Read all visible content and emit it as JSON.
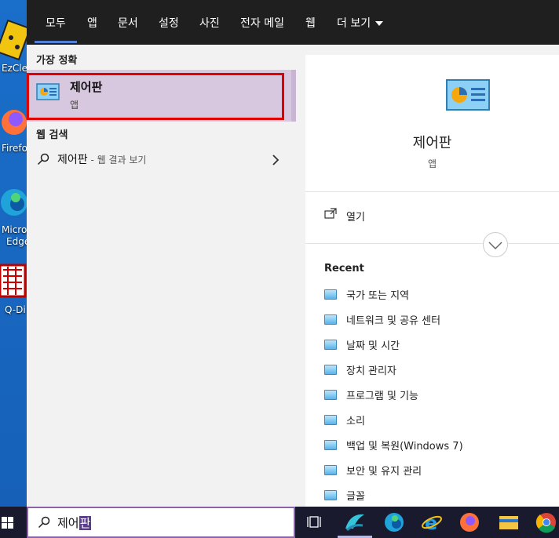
{
  "desktop": {
    "icons": [
      {
        "label": "EzCle"
      },
      {
        "label": "Firefo"
      },
      {
        "label": "Micros"
      },
      {
        "label": "Edge"
      },
      {
        "label": "Q-Di"
      }
    ]
  },
  "tabs": [
    {
      "label": "모두"
    },
    {
      "label": "앱"
    },
    {
      "label": "문서"
    },
    {
      "label": "설정"
    },
    {
      "label": "사진"
    },
    {
      "label": "전자 메일"
    },
    {
      "label": "웹"
    },
    {
      "label": "더 보기"
    }
  ],
  "left": {
    "best_match_header": "가장 정확",
    "best_match": {
      "title": "제어판",
      "subtitle": "앱"
    },
    "web_header": "웹 검색",
    "web_result": {
      "query": "제어판",
      "suffix": " - 웹 결과 보기"
    }
  },
  "right": {
    "title": "제어판",
    "subtitle": "앱",
    "open_label": "열기",
    "recent_header": "Recent",
    "recent_items": [
      "국가 또는 지역",
      "네트워크 및 공유 센터",
      "날짜 및 시간",
      "장치 관리자",
      "프로그램 및 기능",
      "소리",
      "백업 및 복원(Windows 7)",
      "보안 및 유지 관리",
      "글꼴"
    ]
  },
  "taskbar": {
    "search_typed": "제어",
    "search_composing": "판"
  },
  "colors": {
    "accent": "#4d7fd6",
    "highlight": "#d8c8df",
    "red_box": "#e00000"
  }
}
